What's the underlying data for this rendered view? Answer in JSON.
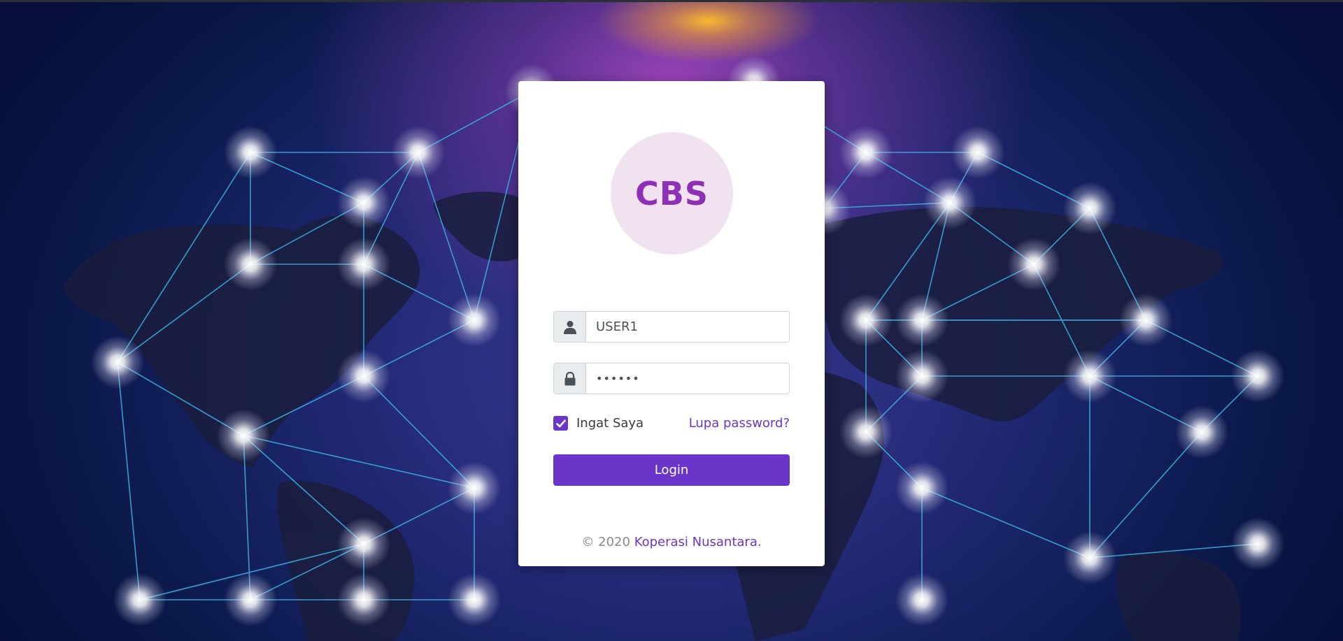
{
  "logo": {
    "text": "CBS"
  },
  "form": {
    "username_value": "USER1",
    "password_value": "••••••",
    "remember_label": "Ingat Saya",
    "remember_checked": true,
    "forgot_label": "Lupa password?",
    "login_label": "Login"
  },
  "footer": {
    "copyright": "© 2020",
    "company": "Koperasi Nusantara."
  },
  "icons": {
    "username": "user-icon",
    "password": "lock-icon",
    "checkbox": "check-icon"
  },
  "colors": {
    "accent": "#6c35c9",
    "logo_text": "#8e2fb8",
    "logo_bg": "#f0e2ee",
    "network_lines": "#3ab4e6"
  }
}
